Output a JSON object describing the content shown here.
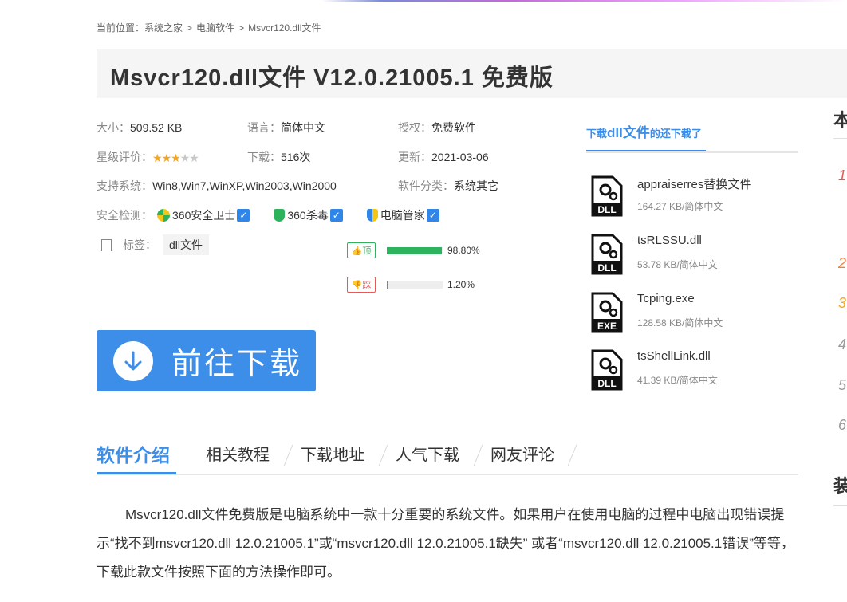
{
  "breadcrumb": {
    "prefix": "当前位置：",
    "items": [
      "系统之家",
      "电脑软件",
      "Msvcr120.dll文件"
    ],
    "separator": ">"
  },
  "title": "Msvcr120.dll文件 V12.0.21005.1 免费版",
  "info": {
    "size_label": "大小：",
    "size": "509.52 KB",
    "lang_label": "语言：",
    "lang": "简体中文",
    "license_label": "授权：",
    "license": "免费软件",
    "rating_label": "星级评价：",
    "rating": 3,
    "rating_max": 5,
    "downloads_label": "下载：",
    "downloads": "516次",
    "update_label": "更新：",
    "update": "2021-03-06",
    "os_label": "支持系统：",
    "os": "Win8,Win7,WinXP,Win2003,Win2000",
    "category_label": "软件分类：",
    "category": "系统其它",
    "security_label": "安全检测：",
    "security": [
      "360安全卫士",
      "360杀毒",
      "电脑管家"
    ],
    "tags_label": "标签：",
    "tag": "dll文件"
  },
  "votes": {
    "up_label": "顶",
    "up_pct": "98.80%",
    "up_value": 98.8,
    "down_label": "踩",
    "down_pct": "1.20%",
    "down_value": 1.2
  },
  "download_button": "前往下载",
  "tabs": [
    "软件介绍",
    "相关教程",
    "下载地址",
    "人气下载",
    "网友评论"
  ],
  "description": "Msvcr120.dll文件免费版是电脑系统中一款十分重要的系统文件。如果用户在使用电脑的过程中电脑出现错误提示“找不到msvcr120.dll 12.0.21005.1”或“msvcr120.dll 12.0.21005.1缺失” 或者“msvcr120.dll 12.0.21005.1错误”等等，下载此款文件按照下面的方法操作即可。",
  "sidebar": {
    "heading_pre": "下载",
    "heading_bold": "dll文件",
    "heading_post": "的还下载了",
    "files": [
      {
        "name": "appraiserres替换文件",
        "meta": "164.27 KB/简体中文",
        "type": "DLL"
      },
      {
        "name": "tsRLSSU.dll",
        "meta": "53.78 KB/简体中文",
        "type": "DLL"
      },
      {
        "name": "Tcping.exe",
        "meta": "128.58 KB/简体中文",
        "type": "EXE"
      },
      {
        "name": "tsShellLink.dll",
        "meta": "41.39 KB/简体中文",
        "type": "DLL"
      }
    ]
  },
  "right_column": {
    "heading1": "本",
    "numbers": [
      "1",
      "2",
      "3",
      "4",
      "5",
      "6"
    ],
    "heading2": "装"
  },
  "colors": {
    "accent": "#3d8ee9",
    "up": "#2db35b",
    "down": "#e55858",
    "star": "#f5a623"
  }
}
